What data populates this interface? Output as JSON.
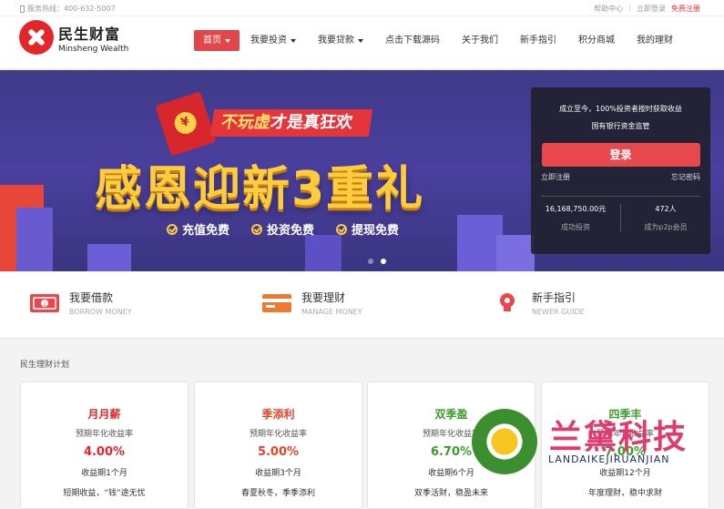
{
  "topbar": {
    "hotline": "服务热线：400-632-5007",
    "help": "帮助中心",
    "login": "立即登录",
    "register": "免费注册"
  },
  "brand": {
    "name_cn": "民生财富",
    "name_en": "Minsheng Wealth"
  },
  "nav": [
    {
      "label": "首页",
      "dropdown": true,
      "active": true
    },
    {
      "label": "我要投资",
      "dropdown": true
    },
    {
      "label": "我要贷款",
      "dropdown": true
    },
    {
      "label": "点击下载源码"
    },
    {
      "label": "关于我们"
    },
    {
      "label": "新手指引"
    },
    {
      "label": "积分商城"
    },
    {
      "label": "我的理财"
    }
  ],
  "banner": {
    "ribbon_a": "不玩虚",
    "ribbon_b": "才是真狂欢",
    "envelope_symbol": "¥",
    "headline": "感恩迎新3重礼",
    "perks": [
      "充值免费",
      "投资免费",
      "提现免费"
    ],
    "slides": 2,
    "active_slide": 2
  },
  "login_panel": {
    "line1": "成立至今，100%投资者按时获取收益",
    "line2": "国有银行资金监管",
    "button": "登录",
    "register_link": "立即注册",
    "forgot_link": "忘记密码",
    "stats": [
      {
        "value": "16,168,750.00元",
        "label": "成功投资"
      },
      {
        "value": "472人",
        "label": "成为p2p会员"
      }
    ]
  },
  "features": [
    {
      "title": "我要借款",
      "subtitle": "BORROW MONEY",
      "icon": "money-icon"
    },
    {
      "title": "我要理财",
      "subtitle": "MANAGE MONEY",
      "icon": "card-icon"
    },
    {
      "title": "新手指引",
      "subtitle": "NEWER GUIDE",
      "icon": "bulb-icon"
    }
  ],
  "plans_title": "民生理财计划",
  "plans": [
    {
      "name": "月月薪",
      "rate_label": "预期年化收益率",
      "rate": "4.00%",
      "term": "收益期1个月",
      "slogan": "短期收益，“钱”途无忧",
      "color": "#e2262a"
    },
    {
      "name": "季添利",
      "rate_label": "预期年化收益率",
      "rate": "5.00%",
      "term": "收益期3个月",
      "slogan": "春夏秋冬，季季添利",
      "color": "#e2462a"
    },
    {
      "name": "双季盈",
      "rate_label": "预期年化收益率",
      "rate": "6.70%",
      "term": "收益期6个月",
      "slogan": "双季活财，稳盈未来",
      "color": "#3f9b2c"
    },
    {
      "name": "四季丰",
      "rate_label": "预期年化收益率",
      "rate": "7.00%",
      "term": "收益期12个月",
      "slogan": "年度理财，稳中求财",
      "color": "#3f9b2c"
    }
  ],
  "watermark": {
    "cn": "兰黛科技",
    "en": "LANDAIKEJIRUANJIAN"
  },
  "colors": {
    "accent": "#e2464a",
    "banner_bg": "#3f3a8a",
    "gold": "#ffcc3d"
  }
}
